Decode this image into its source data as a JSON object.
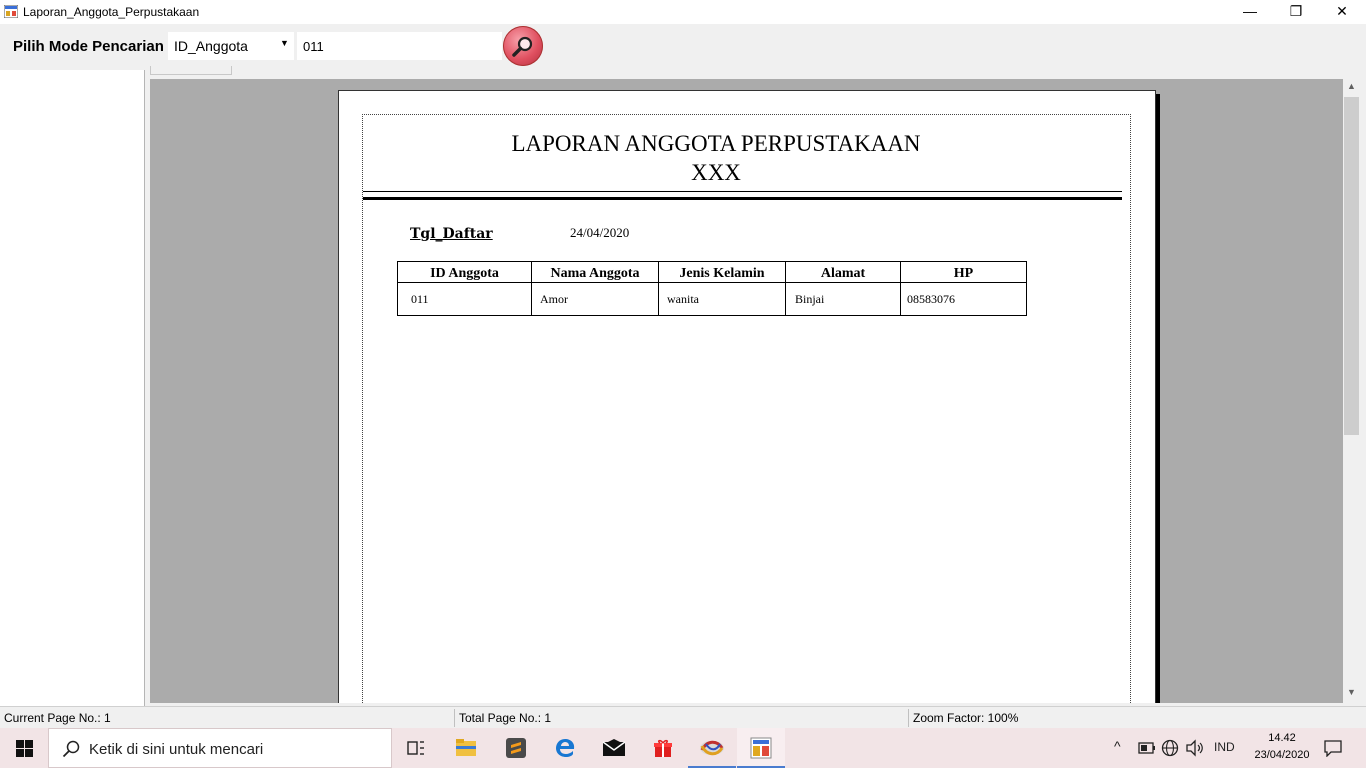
{
  "window": {
    "title": "Laporan_Anggota_Perpustakaan",
    "minimize": "—",
    "maximize": "❐",
    "close": "✕"
  },
  "toolbar": {
    "mode_label": "Pilih Mode Pencarian",
    "mode_value": "ID_Anggota",
    "search_value": "011"
  },
  "report": {
    "title_line1": "LAPORAN ANGGOTA PERPUSTAKAAN",
    "title_line2": "XXX",
    "date_label": "Tgl_Daftar",
    "date_value": "24/04/2020",
    "columns": [
      "ID Anggota",
      "Nama Anggota",
      "Jenis Kelamin",
      "Alamat",
      "HP"
    ],
    "rows": [
      [
        "011",
        "Amor",
        "wanita",
        "Binjai",
        "08583076"
      ]
    ]
  },
  "statusbar": {
    "current_page": "Current Page No.: 1",
    "total_page": "Total Page No.: 1",
    "zoom": "Zoom Factor: 100%"
  },
  "taskbar": {
    "search_placeholder": "Ketik di sini untuk mencari",
    "language": "IND",
    "time": "14.42",
    "date": "23/04/2020",
    "accent_color": "#4a7ccf"
  }
}
